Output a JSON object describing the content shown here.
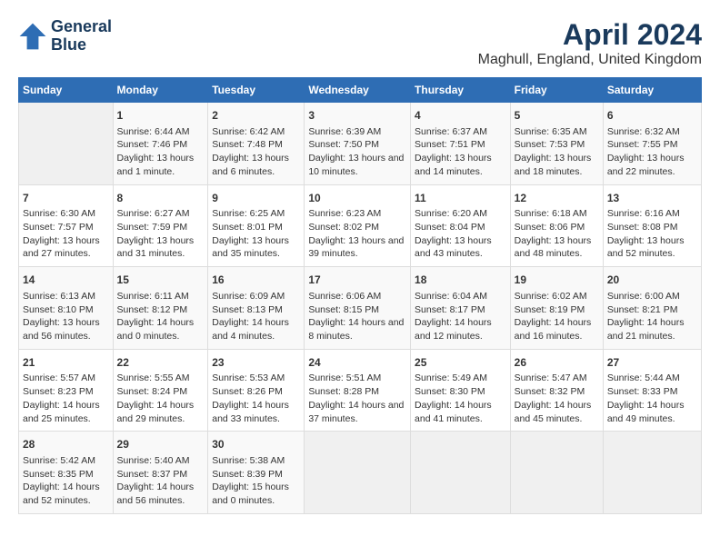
{
  "logo": {
    "line1": "General",
    "line2": "Blue"
  },
  "title": "April 2024",
  "subtitle": "Maghull, England, United Kingdom",
  "days_header": [
    "Sunday",
    "Monday",
    "Tuesday",
    "Wednesday",
    "Thursday",
    "Friday",
    "Saturday"
  ],
  "weeks": [
    [
      {
        "day": "",
        "sunrise": "",
        "sunset": "",
        "daylight": ""
      },
      {
        "day": "1",
        "sunrise": "Sunrise: 6:44 AM",
        "sunset": "Sunset: 7:46 PM",
        "daylight": "Daylight: 13 hours and 1 minute."
      },
      {
        "day": "2",
        "sunrise": "Sunrise: 6:42 AM",
        "sunset": "Sunset: 7:48 PM",
        "daylight": "Daylight: 13 hours and 6 minutes."
      },
      {
        "day": "3",
        "sunrise": "Sunrise: 6:39 AM",
        "sunset": "Sunset: 7:50 PM",
        "daylight": "Daylight: 13 hours and 10 minutes."
      },
      {
        "day": "4",
        "sunrise": "Sunrise: 6:37 AM",
        "sunset": "Sunset: 7:51 PM",
        "daylight": "Daylight: 13 hours and 14 minutes."
      },
      {
        "day": "5",
        "sunrise": "Sunrise: 6:35 AM",
        "sunset": "Sunset: 7:53 PM",
        "daylight": "Daylight: 13 hours and 18 minutes."
      },
      {
        "day": "6",
        "sunrise": "Sunrise: 6:32 AM",
        "sunset": "Sunset: 7:55 PM",
        "daylight": "Daylight: 13 hours and 22 minutes."
      }
    ],
    [
      {
        "day": "7",
        "sunrise": "Sunrise: 6:30 AM",
        "sunset": "Sunset: 7:57 PM",
        "daylight": "Daylight: 13 hours and 27 minutes."
      },
      {
        "day": "8",
        "sunrise": "Sunrise: 6:27 AM",
        "sunset": "Sunset: 7:59 PM",
        "daylight": "Daylight: 13 hours and 31 minutes."
      },
      {
        "day": "9",
        "sunrise": "Sunrise: 6:25 AM",
        "sunset": "Sunset: 8:01 PM",
        "daylight": "Daylight: 13 hours and 35 minutes."
      },
      {
        "day": "10",
        "sunrise": "Sunrise: 6:23 AM",
        "sunset": "Sunset: 8:02 PM",
        "daylight": "Daylight: 13 hours and 39 minutes."
      },
      {
        "day": "11",
        "sunrise": "Sunrise: 6:20 AM",
        "sunset": "Sunset: 8:04 PM",
        "daylight": "Daylight: 13 hours and 43 minutes."
      },
      {
        "day": "12",
        "sunrise": "Sunrise: 6:18 AM",
        "sunset": "Sunset: 8:06 PM",
        "daylight": "Daylight: 13 hours and 48 minutes."
      },
      {
        "day": "13",
        "sunrise": "Sunrise: 6:16 AM",
        "sunset": "Sunset: 8:08 PM",
        "daylight": "Daylight: 13 hours and 52 minutes."
      }
    ],
    [
      {
        "day": "14",
        "sunrise": "Sunrise: 6:13 AM",
        "sunset": "Sunset: 8:10 PM",
        "daylight": "Daylight: 13 hours and 56 minutes."
      },
      {
        "day": "15",
        "sunrise": "Sunrise: 6:11 AM",
        "sunset": "Sunset: 8:12 PM",
        "daylight": "Daylight: 14 hours and 0 minutes."
      },
      {
        "day": "16",
        "sunrise": "Sunrise: 6:09 AM",
        "sunset": "Sunset: 8:13 PM",
        "daylight": "Daylight: 14 hours and 4 minutes."
      },
      {
        "day": "17",
        "sunrise": "Sunrise: 6:06 AM",
        "sunset": "Sunset: 8:15 PM",
        "daylight": "Daylight: 14 hours and 8 minutes."
      },
      {
        "day": "18",
        "sunrise": "Sunrise: 6:04 AM",
        "sunset": "Sunset: 8:17 PM",
        "daylight": "Daylight: 14 hours and 12 minutes."
      },
      {
        "day": "19",
        "sunrise": "Sunrise: 6:02 AM",
        "sunset": "Sunset: 8:19 PM",
        "daylight": "Daylight: 14 hours and 16 minutes."
      },
      {
        "day": "20",
        "sunrise": "Sunrise: 6:00 AM",
        "sunset": "Sunset: 8:21 PM",
        "daylight": "Daylight: 14 hours and 21 minutes."
      }
    ],
    [
      {
        "day": "21",
        "sunrise": "Sunrise: 5:57 AM",
        "sunset": "Sunset: 8:23 PM",
        "daylight": "Daylight: 14 hours and 25 minutes."
      },
      {
        "day": "22",
        "sunrise": "Sunrise: 5:55 AM",
        "sunset": "Sunset: 8:24 PM",
        "daylight": "Daylight: 14 hours and 29 minutes."
      },
      {
        "day": "23",
        "sunrise": "Sunrise: 5:53 AM",
        "sunset": "Sunset: 8:26 PM",
        "daylight": "Daylight: 14 hours and 33 minutes."
      },
      {
        "day": "24",
        "sunrise": "Sunrise: 5:51 AM",
        "sunset": "Sunset: 8:28 PM",
        "daylight": "Daylight: 14 hours and 37 minutes."
      },
      {
        "day": "25",
        "sunrise": "Sunrise: 5:49 AM",
        "sunset": "Sunset: 8:30 PM",
        "daylight": "Daylight: 14 hours and 41 minutes."
      },
      {
        "day": "26",
        "sunrise": "Sunrise: 5:47 AM",
        "sunset": "Sunset: 8:32 PM",
        "daylight": "Daylight: 14 hours and 45 minutes."
      },
      {
        "day": "27",
        "sunrise": "Sunrise: 5:44 AM",
        "sunset": "Sunset: 8:33 PM",
        "daylight": "Daylight: 14 hours and 49 minutes."
      }
    ],
    [
      {
        "day": "28",
        "sunrise": "Sunrise: 5:42 AM",
        "sunset": "Sunset: 8:35 PM",
        "daylight": "Daylight: 14 hours and 52 minutes."
      },
      {
        "day": "29",
        "sunrise": "Sunrise: 5:40 AM",
        "sunset": "Sunset: 8:37 PM",
        "daylight": "Daylight: 14 hours and 56 minutes."
      },
      {
        "day": "30",
        "sunrise": "Sunrise: 5:38 AM",
        "sunset": "Sunset: 8:39 PM",
        "daylight": "Daylight: 15 hours and 0 minutes."
      },
      {
        "day": "",
        "sunrise": "",
        "sunset": "",
        "daylight": ""
      },
      {
        "day": "",
        "sunrise": "",
        "sunset": "",
        "daylight": ""
      },
      {
        "day": "",
        "sunrise": "",
        "sunset": "",
        "daylight": ""
      },
      {
        "day": "",
        "sunrise": "",
        "sunset": "",
        "daylight": ""
      }
    ]
  ]
}
